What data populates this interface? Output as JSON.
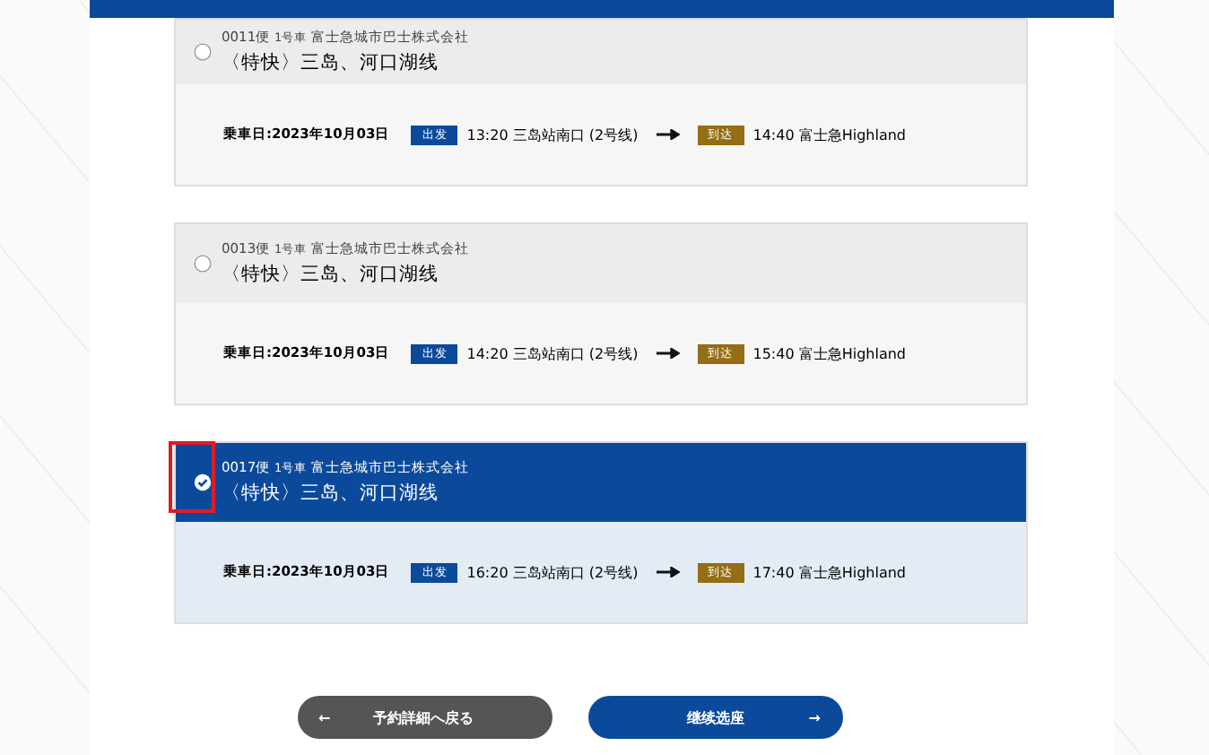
{
  "trips": [
    {
      "flight": "0011便",
      "car": "1号車",
      "company": "富士急城市巴士株式会社",
      "route": "〈特快〉三岛、河口湖线",
      "date": "乗車日:2023年10月03日",
      "depart_label": "出发",
      "depart": "13:20 三岛站南口 (2号线)",
      "arrive_label": "到达",
      "arrive": "14:40 富士急Highland",
      "selected": false
    },
    {
      "flight": "0013便",
      "car": "1号車",
      "company": "富士急城市巴士株式会社",
      "route": "〈特快〉三岛、河口湖线",
      "date": "乗車日:2023年10月03日",
      "depart_label": "出发",
      "depart": "14:20 三岛站南口 (2号线)",
      "arrive_label": "到达",
      "arrive": "15:40 富士急Highland",
      "selected": false
    },
    {
      "flight": "0017便",
      "car": "1号車",
      "company": "富士急城市巴士株式会社",
      "route": "〈特快〉三岛、河口湖线",
      "date": "乗車日:2023年10月03日",
      "depart_label": "出发",
      "depart": "16:20 三岛站南口 (2号线)",
      "arrive_label": "到达",
      "arrive": "17:40 富士急Highland",
      "selected": true
    }
  ],
  "back_button": {
    "label": "予約詳細へ戻る",
    "icon": "←"
  },
  "next_button": {
    "label": "继续选座",
    "icon": "→"
  }
}
